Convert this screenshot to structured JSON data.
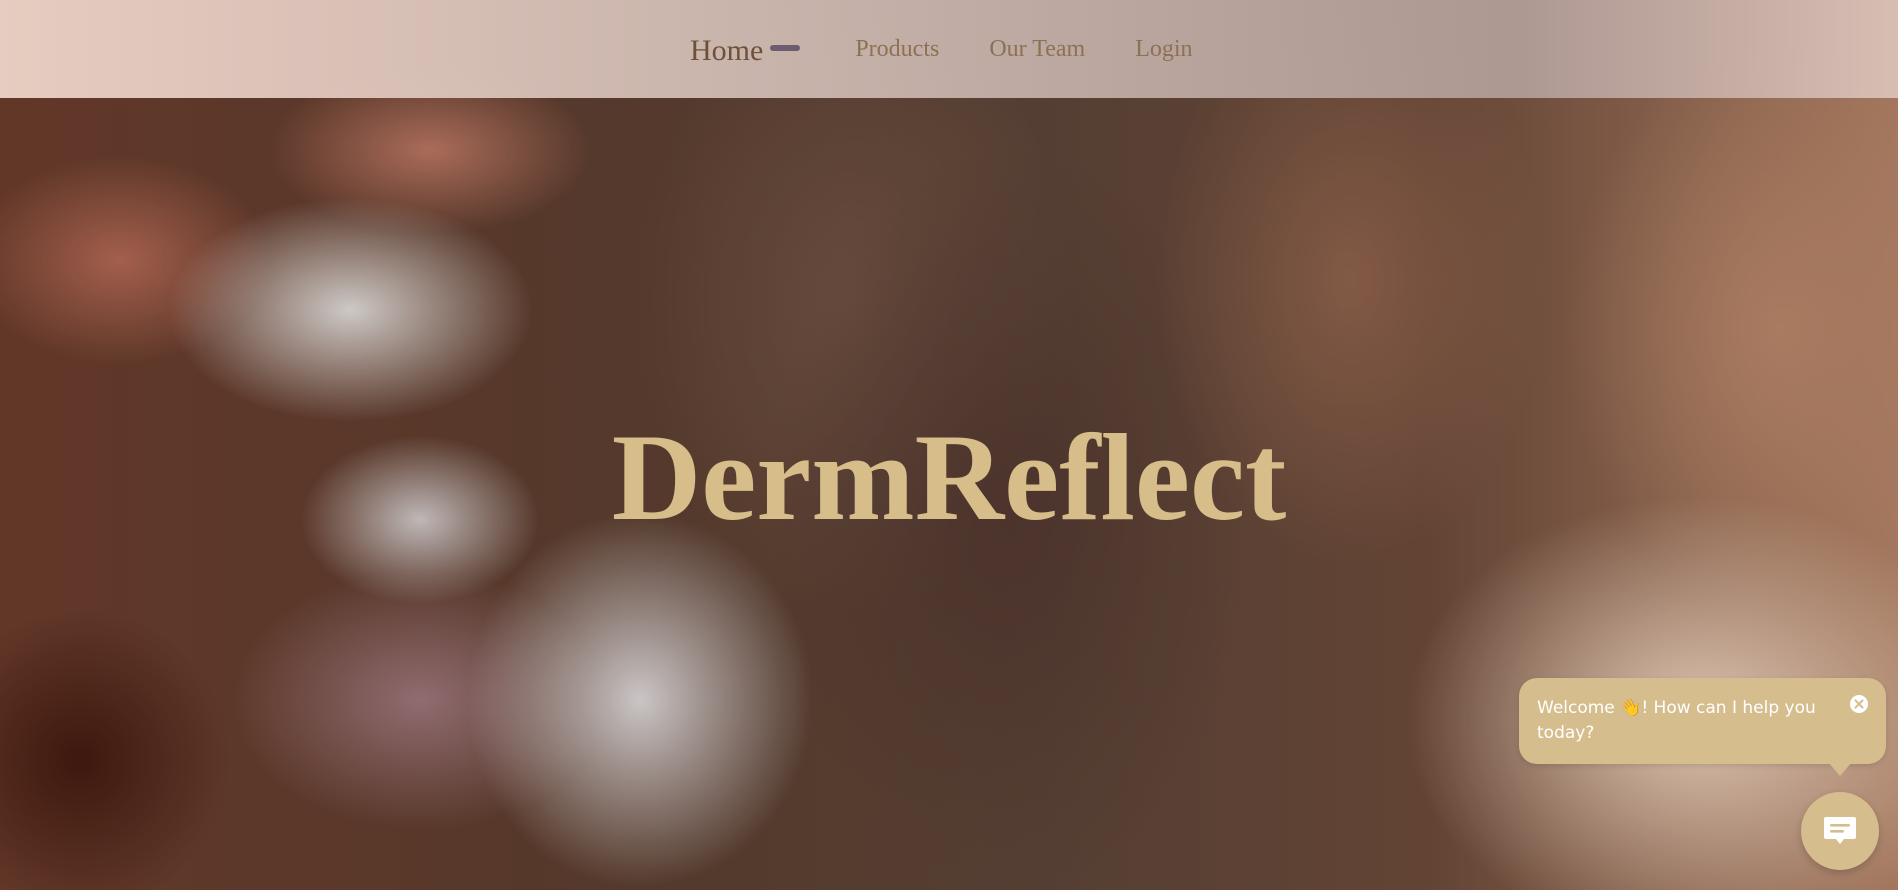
{
  "nav": {
    "items": [
      {
        "label": "Home",
        "active": true
      },
      {
        "label": "Products",
        "active": false
      },
      {
        "label": "Our Team",
        "active": false
      },
      {
        "label": "Login",
        "active": false
      }
    ]
  },
  "hero": {
    "title": "DermReflect"
  },
  "chat": {
    "message": "Welcome 👋! How can I help you today?",
    "close_icon": "close-circle-icon",
    "launcher_icon": "chat-message-icon"
  },
  "colors": {
    "accent_gold": "#d5bd8e",
    "title_gold": "#d6bd8a",
    "nav_text": "#8c7153",
    "active_indicator": "#6d5c6e"
  }
}
